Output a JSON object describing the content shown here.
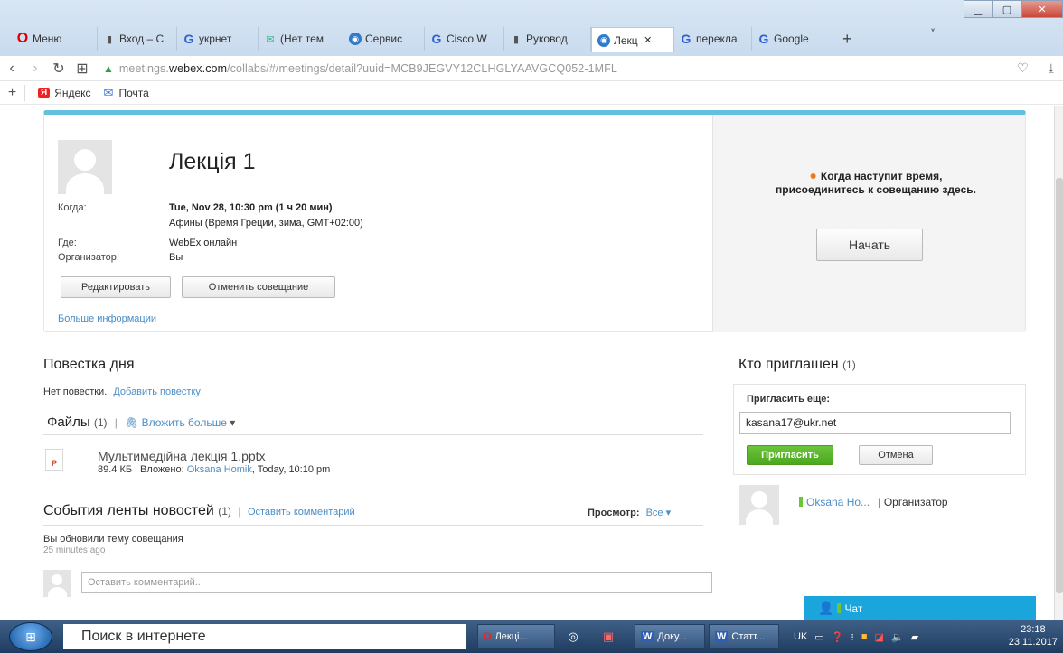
{
  "browser": {
    "tabs": [
      {
        "label": "Меню",
        "icon": "opera-icon"
      },
      {
        "label": "Вход – С",
        "icon": "document-icon"
      },
      {
        "label": "укрнет",
        "icon": "google-icon"
      },
      {
        "label": "(Нет тем",
        "icon": "mail-icon"
      },
      {
        "label": "Сервис",
        "icon": "globe-icon"
      },
      {
        "label": "Cisco W",
        "icon": "google-icon"
      },
      {
        "label": "Руковод",
        "icon": "document-icon"
      },
      {
        "label": "Лекц",
        "icon": "globe-icon",
        "active": true
      },
      {
        "label": "перекла",
        "icon": "google-icon"
      },
      {
        "label": "Google",
        "icon": "translate-icon"
      }
    ],
    "url_prefix": "meetings.",
    "url_domain": "webex.com",
    "url_path": "/collabs/#/meetings/detail?uuid=MCB9JEGVY12CLHGLYAAVGCQ052-1MFL",
    "bookmarks": [
      {
        "label": "Яндекс",
        "icon": "yandex-icon"
      },
      {
        "label": "Почта",
        "icon": "mail-icon"
      }
    ]
  },
  "meeting": {
    "title": "Лекція 1",
    "when_label": "Когда:",
    "when_value": "Tue, Nov 28, 10:30 pm  (1 ч 20 мин)",
    "timezone": "Афины (Время Греции, зима, GMT+02:00)",
    "where_label": "Где:",
    "where_value": "WebEx онлайн",
    "organizer_label": "Организатор:",
    "organizer_value": "Вы",
    "edit_button": "Редактировать",
    "cancel_meeting_button": "Отменить совещание",
    "more_info_link": "Больше информации",
    "notice": "Когда наступит время, присоединитесь к совещанию здесь.",
    "start_button": "Начать"
  },
  "agenda": {
    "heading": "Повестка дня",
    "empty_text": "Нет повестки.",
    "add_link": "Добавить повестку"
  },
  "files": {
    "heading": "Файлы",
    "count": "(1)",
    "separator": "|",
    "attach_link": "Вложить больше",
    "items": [
      {
        "name": "Мультимедійна лекція 1.pptx",
        "size_prefix": "89.4 КБ | Вложено:",
        "author": "Oksana Homik",
        "time": ", Today, 10:10 pm"
      }
    ]
  },
  "feed": {
    "heading": "События ленты новостей",
    "count": "(1)",
    "separator": "|",
    "comment_link": "Оставить комментарий",
    "view_label": "Просмотр:",
    "view_value": "Все",
    "event_text": "Вы обновили тему совещания",
    "event_time": "25 minutes ago",
    "comment_placeholder": "Оставить комментарий..."
  },
  "invitees": {
    "heading": "Кто приглашен",
    "count": "(1)",
    "invite_more_label": "Пригласить еще:",
    "email_value": "kasana17@ukr.net",
    "invite_button": "Пригласить",
    "cancel_button": "Отмена",
    "people": [
      {
        "name": "Oksana Ho...",
        "role": "| Организатор"
      }
    ]
  },
  "chat": {
    "label": "Чат"
  },
  "taskbar": {
    "search_text": "Поиск в интернете",
    "apps": [
      {
        "label": "Лекці..."
      },
      {
        "label": "Доку..."
      },
      {
        "label": "Статт..."
      }
    ],
    "language": "UK",
    "time": "23:18",
    "date": "23.11.2017"
  },
  "colors": {
    "accent": "#62c0dc",
    "link": "#4a8ec6",
    "invite_green": "#4aa81f",
    "chat_blue": "#1aa5dc",
    "notice_dot": "#f07b16"
  }
}
